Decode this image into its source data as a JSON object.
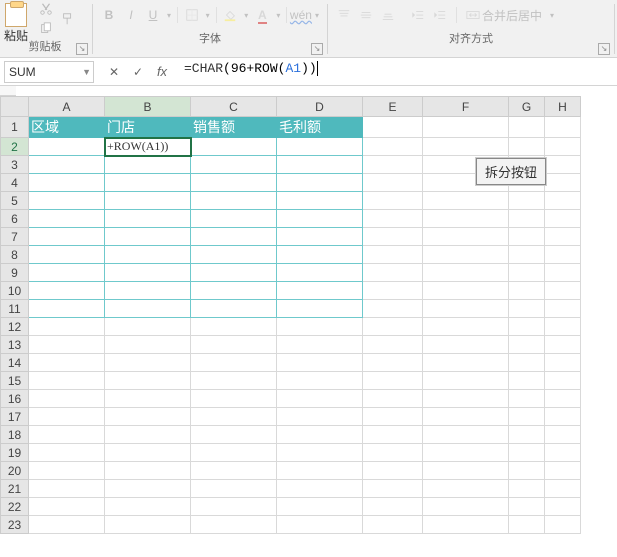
{
  "ribbon": {
    "paste_label": "粘贴",
    "group_clipboard": "剪贴板",
    "group_font": "字体",
    "group_align": "对齐方式",
    "bold": "B",
    "italic": "I",
    "underline": "U",
    "merge_label": "合并后居中",
    "wen": "wén",
    "font_letter": "A"
  },
  "formula_bar": {
    "name_box": "SUM",
    "cancel": "✕",
    "accept": "✓",
    "fx": "fx",
    "formula_prefix": "=CHAR",
    "formula_open": "(",
    "formula_n1": "96+ROW",
    "formula_open2": "(",
    "formula_ref": "A1",
    "formula_close2": ")",
    "formula_close": ")"
  },
  "sheet": {
    "columns": [
      "A",
      "B",
      "C",
      "D",
      "E",
      "F",
      "G",
      "H"
    ],
    "rows": [
      "1",
      "2",
      "3",
      "4",
      "5",
      "6",
      "7",
      "8",
      "9",
      "10",
      "11",
      "12",
      "13",
      "14",
      "15",
      "16",
      "17",
      "18",
      "19",
      "20",
      "21",
      "22",
      "23"
    ],
    "headers": {
      "A1": "区域",
      "B1": "门店",
      "C1": "销售额",
      "D1": "毛利额"
    },
    "editing_cell": "B2",
    "editing_display": "+ROW(A1))",
    "button_text": "拆分按钮"
  },
  "icons": {
    "cut": "cut-icon",
    "copy": "copy-icon",
    "format_painter": "format-painter-icon",
    "border": "border-icon",
    "fill": "fill-icon",
    "indent_dec": "indent-decrease-icon",
    "indent_inc": "indent-increase-icon",
    "align_left": "align-left-icon",
    "align_center": "align-center-icon",
    "align_right": "align-right-icon",
    "align_top": "align-top-icon",
    "align_mid": "align-middle-icon",
    "align_bot": "align-bottom-icon"
  }
}
